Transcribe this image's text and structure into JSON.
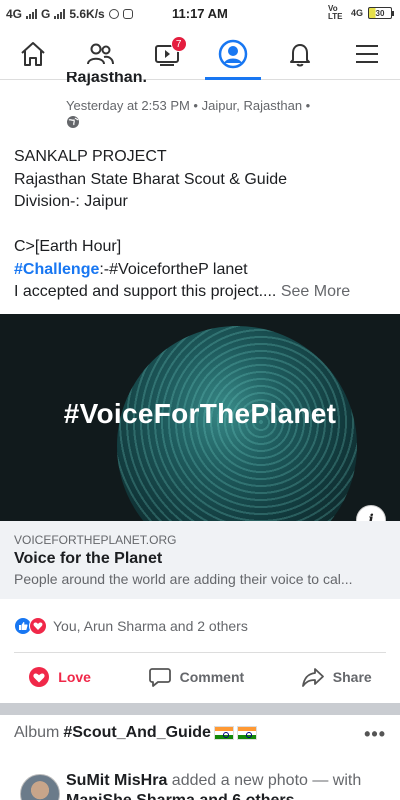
{
  "status_bar": {
    "network_1": "4G",
    "network_2": "G",
    "speed": "5.6K/s",
    "time": "11:17 AM",
    "volte": "Vo LTE",
    "network_3": "4G",
    "battery": "30"
  },
  "nav": {
    "notification_count": "7"
  },
  "post": {
    "author": "Rajasthan.",
    "meta": "Yesterday at 2:53 PM • Jaipur, Rajasthan •",
    "lines": {
      "l1": "SANKALP PROJECT",
      "l2": "Rajasthan State Bharat Scout & Guide",
      "l3": "Division-: Jaipur",
      "l4": "C>[Earth Hour]",
      "hashtag": "#Challenge",
      "l5_rest": ":-#VoicefortheP lanet",
      "l6": "I accepted and support this project....",
      "see_more": "See More"
    }
  },
  "link": {
    "image_text": "#VoiceForThePlanet",
    "domain": "VOICEFORTHEPLANET.ORG",
    "title": "Voice for the Planet",
    "description": "People around the world are adding their voice to cal..."
  },
  "reactions": {
    "text": "You, Arun Sharma and 2 others"
  },
  "actions": {
    "love": "Love",
    "comment": "Comment",
    "share": "Share"
  },
  "album": {
    "prefix": "Album",
    "name": "#Scout_And_Guide",
    "more": "•••"
  },
  "next_post": {
    "author": "SuMit MisHra",
    "action": "added a new photo — with",
    "line2": "ManiShe Sharma and 6 others"
  },
  "colors": {
    "accent": "#1877f2",
    "love": "#f02849",
    "badge": "#e41e3f"
  }
}
